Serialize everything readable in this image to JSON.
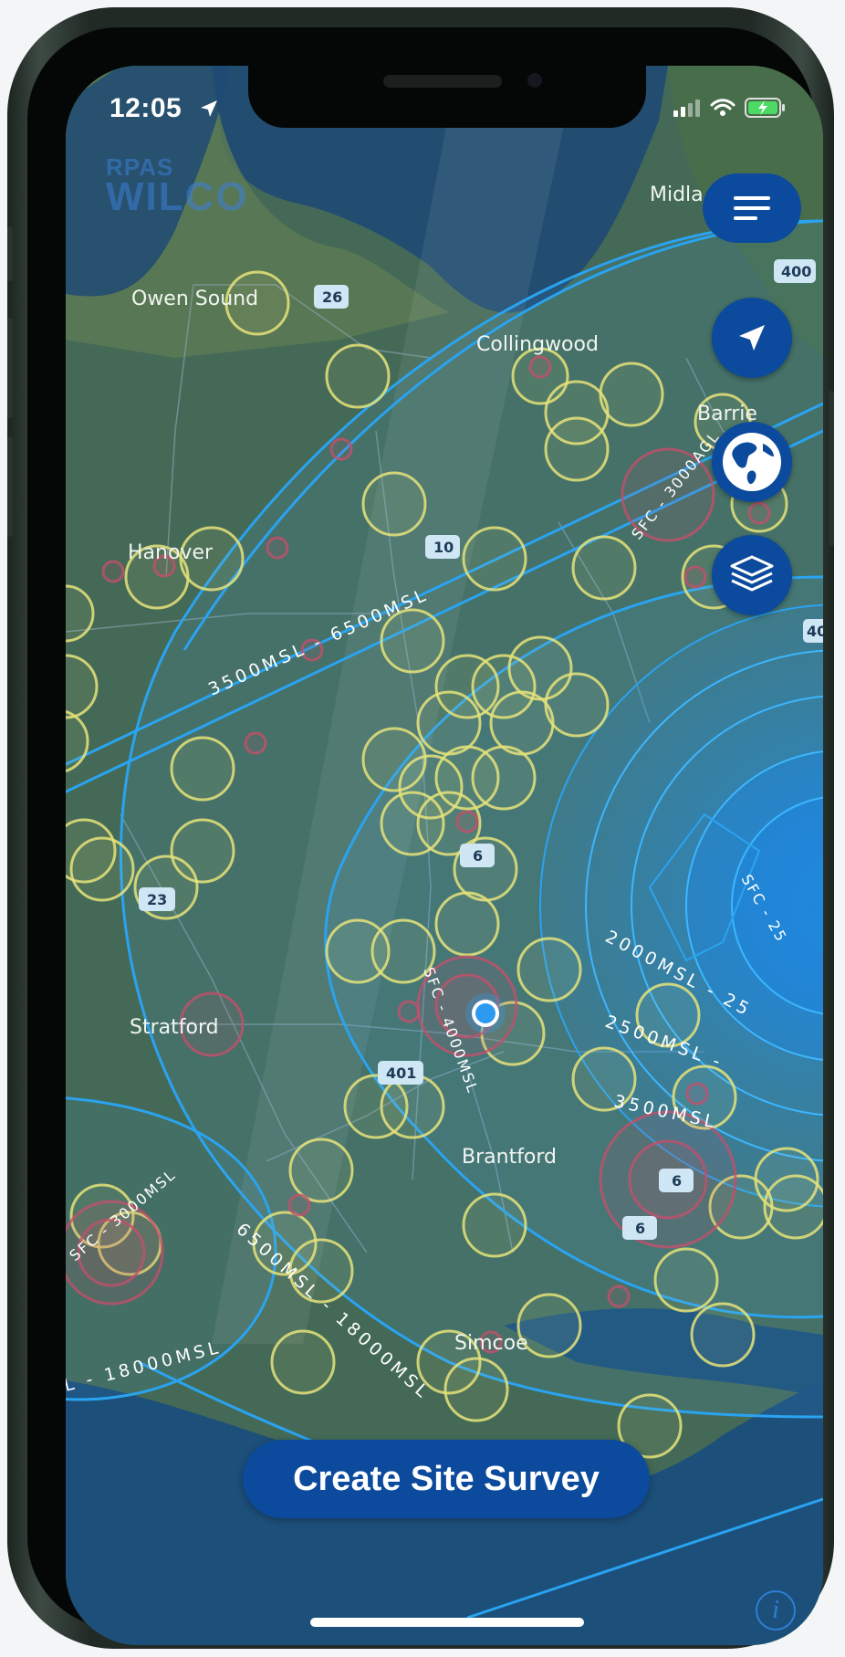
{
  "status": {
    "time": "12:05"
  },
  "logo": {
    "small": "RPAS",
    "big": "WILCO"
  },
  "map": {
    "cities": [
      "Owen Sound",
      "Collingwood",
      "Midla",
      "Barrie",
      "Hanover",
      "Stratford",
      "Brantford",
      "Simcoe"
    ],
    "highways": [
      "26",
      "400",
      "10",
      "40",
      "6",
      "23",
      "401",
      "6",
      "6"
    ],
    "altitude_labels": [
      "3500MSL - 6500MSL",
      "2000MSL - 25",
      "2500MSL -",
      "3500MSL",
      "6500MSL - 18000MSL",
      "L - 18000MSL",
      "SFC - 3000AGL",
      "SFC - 3000MSL",
      "SFC - 4000MSL",
      "SFC - 25"
    ]
  },
  "controls": {
    "menu": "menu-icon",
    "locate": "location-arrow-icon",
    "globe": "globe-icon",
    "layers": "layers-icon",
    "info": "i"
  },
  "cta": {
    "label": "Create Site Survey"
  },
  "colors": {
    "accent": "#0b4a9c",
    "airspace": "#2aa3f0",
    "zone_yellow": "#e6e37a",
    "zone_red": "#c2506c"
  }
}
